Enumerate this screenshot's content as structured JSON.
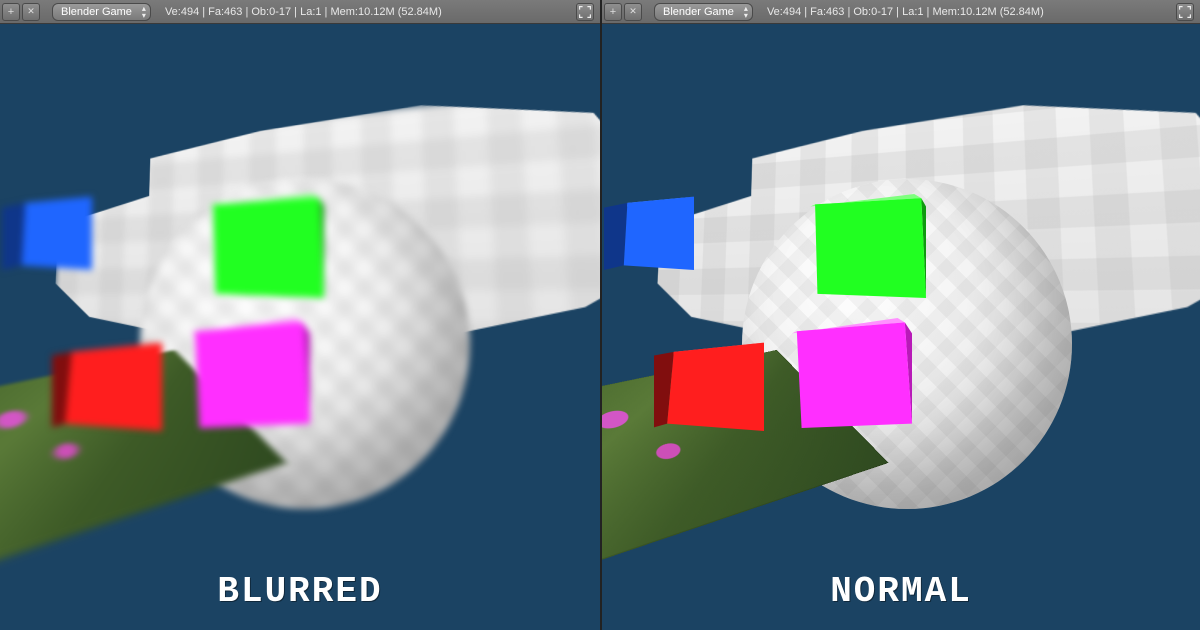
{
  "header": {
    "engine_label": "Blender Game",
    "stats": "Ve:494 | Fa:463 | Ob:0-17 | La:1 | Mem:10.12M (52.84M)"
  },
  "panes": [
    {
      "caption": "BLURRED",
      "effect": "blur"
    },
    {
      "caption": "NORMAL",
      "effect": "none"
    }
  ],
  "scene": {
    "objects": [
      {
        "name": "wall",
        "color": "#eeeeee"
      },
      {
        "name": "sphere",
        "color": "#f2f2f2"
      },
      {
        "name": "plane",
        "color": "#4b6b2f"
      },
      {
        "name": "cube-blue",
        "color": "#1f66ff"
      },
      {
        "name": "cube-green",
        "color": "#21ff21"
      },
      {
        "name": "cube-red",
        "color": "#ff1e1e"
      },
      {
        "name": "cube-pink",
        "color": "#ff2fff"
      }
    ]
  },
  "icons": {
    "add": "+",
    "close": "✕",
    "fullscreen": "⛶"
  }
}
